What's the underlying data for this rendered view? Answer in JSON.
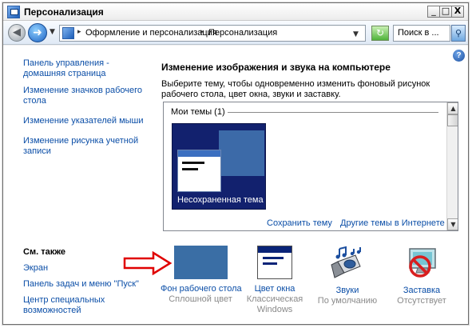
{
  "window": {
    "title": "Персонализация",
    "minimize": "_",
    "maximize": "□",
    "close": "X"
  },
  "address_bar": {
    "back_glyph": "◀",
    "forward_glyph": "➜",
    "path": [
      "Оформление и персонализация",
      "Персонализация"
    ],
    "search_placeholder": "Поиск в ...",
    "search_glyph": "⚲",
    "refresh_glyph": "↻"
  },
  "help": "?",
  "tasks": [
    "Панель управления - домашняя страница",
    "Изменение значков рабочего стола",
    "Изменение указателей мыши",
    "Изменение рисунка учетной записи"
  ],
  "see_also": {
    "title": "См. также",
    "links": [
      "Экран",
      "Панель задач и меню \"Пуск\"",
      "Центр специальных возможностей"
    ]
  },
  "main": {
    "heading": "Изменение изображения и звука на компьютере",
    "description": "Выберите тему, чтобы одновременно изменить фоновый рисунок рабочего стола, цвет окна, звуки и заставку.",
    "group_label": "Мои темы (1)",
    "theme_name": "Несохраненная тема",
    "save_theme": "Сохранить тему",
    "online_themes": "Другие темы в Интернете"
  },
  "items": [
    {
      "label": "Фон рабочего стола",
      "value": "Сплошной цвет",
      "icon": "desktop-background-icon",
      "color": "#3a6ea5"
    },
    {
      "label": "Цвет окна",
      "value": "Классическая Windows",
      "icon": "window-color-icon"
    },
    {
      "label": "Звуки",
      "value": "По умолчанию",
      "icon": "sounds-icon"
    },
    {
      "label": "Заставка",
      "value": "Отсутствует",
      "icon": "screensaver-icon"
    }
  ],
  "colors": {
    "link": "#0b4ea7",
    "annotation_arrow": "#e00000",
    "theme_background": "#12216e"
  }
}
